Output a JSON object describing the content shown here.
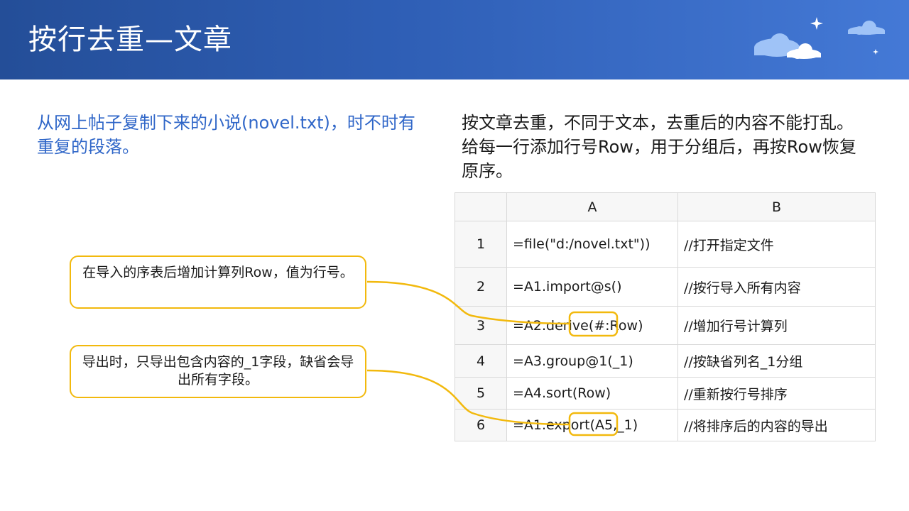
{
  "header": {
    "title": "按行去重—文章"
  },
  "left_description": "从网上帖子复制下来的小说(novel.txt)，时不时有重复的段落。",
  "right_description": "按文章去重，不同于文本，去重后的内容不能打乱。给每一行添加行号Row，用于分组后，再按Row恢复原序。",
  "callouts": [
    {
      "text": "在导入的序表后增加计算列Row，值为行号。"
    },
    {
      "text": "导出时，只导出包含内容的_1字段，缺省会导出所有字段。"
    }
  ],
  "table": {
    "columns": [
      "",
      "A",
      "B"
    ],
    "rows": [
      {
        "num": "1",
        "a": "=file(\"d:/novel.txt\"))",
        "b": "//打开指定文件"
      },
      {
        "num": "2",
        "a": "=A1.import@s()",
        "b": "//按行导入所有内容"
      },
      {
        "num": "3",
        "a": "=A2.derive(#:Row)",
        "b": "//增加行号计算列"
      },
      {
        "num": "4",
        "a": "=A3.group@1(_1)",
        "b": "//按缺省列名_1分组"
      },
      {
        "num": "5",
        "a": "=A4.sort(Row)",
        "b": "//重新按行号排序"
      },
      {
        "num": "6",
        "a": "=A1.export(A5,_1)",
        "b": "//将排序后的内容的导出"
      }
    ]
  },
  "colors": {
    "header_bg": "#2f5fb6",
    "accent_blue": "#2f66c8",
    "callout_border": "#f2b90d"
  }
}
